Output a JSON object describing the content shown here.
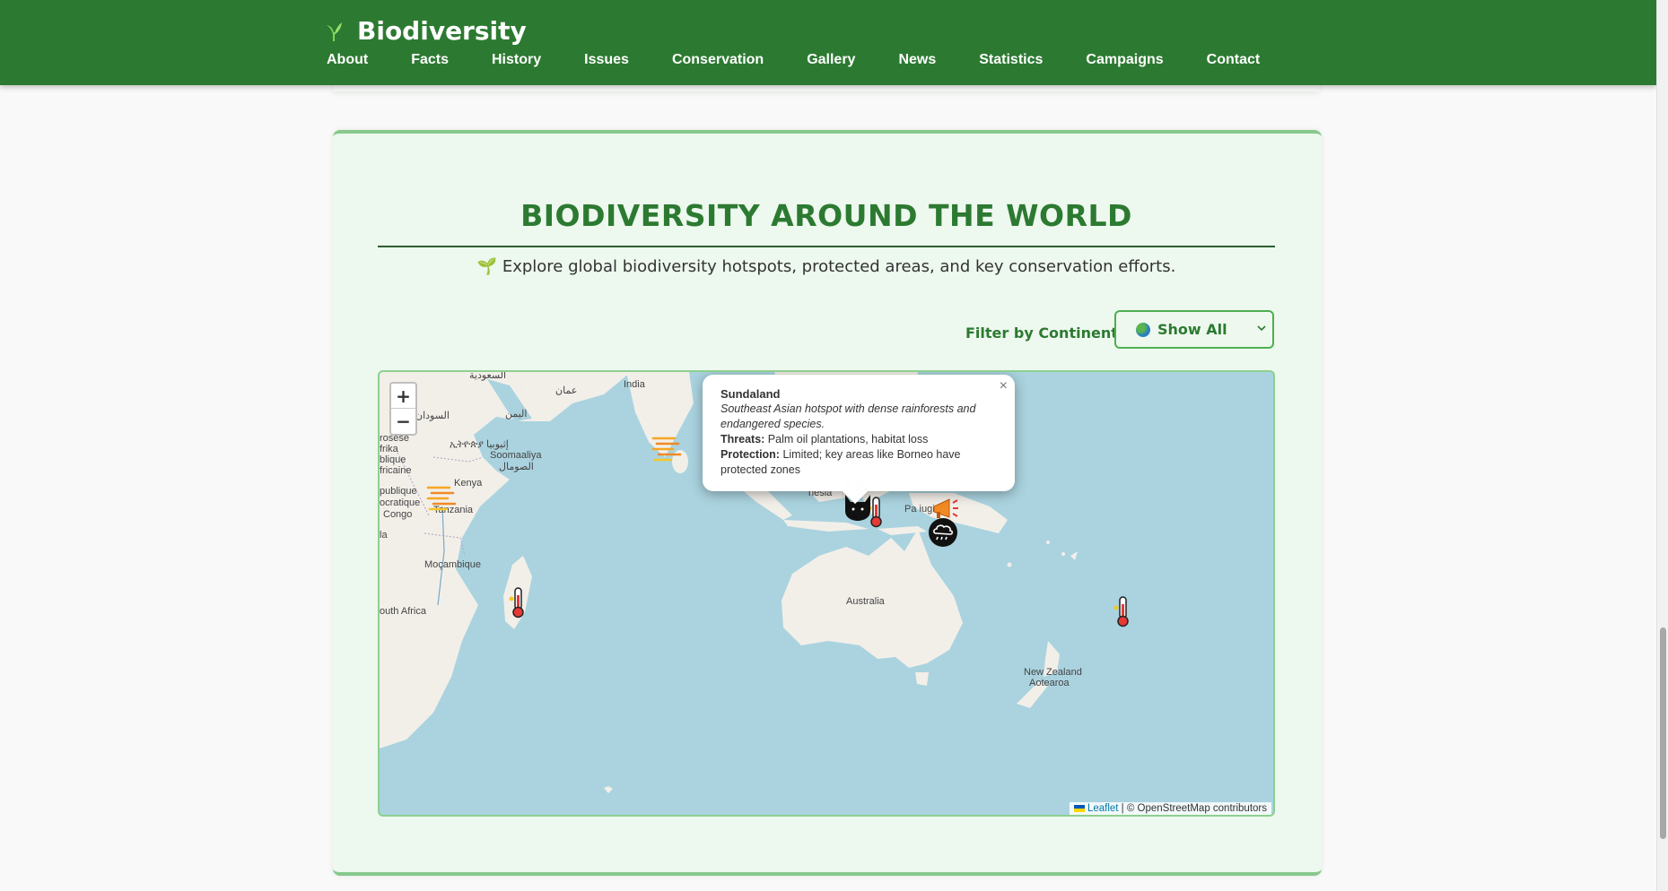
{
  "header": {
    "brand": "Biodiversity",
    "nav": [
      "About",
      "Facts",
      "History",
      "Issues",
      "Conservation",
      "Gallery",
      "News",
      "Statistics",
      "Campaigns",
      "Contact"
    ]
  },
  "section": {
    "title": "BIODIVERSITY AROUND THE WORLD",
    "subtitle": "🌱 Explore global biodiversity hotspots, protected areas, and key conservation efforts.",
    "filter": {
      "label": "Filter by Continent:",
      "value": "Show All"
    }
  },
  "map": {
    "zoom_in": "+",
    "zoom_out": "−",
    "labels": {
      "india": "India",
      "oman": "عمان",
      "saudi": "السعودية",
      "yemen": "اليمن",
      "sudan": "السودان",
      "ethiopia": "ኢትዮጵያ إثيوبيا",
      "somalia": "Soomaaliya",
      "somalia_ar": "الصومال",
      "car1": "rosèse",
      "car2": "frika",
      "car3": "blique",
      "car4": "fricaine",
      "drc1": "publique",
      "drc2": "ocratique",
      "drc3": "Congo",
      "kenya": "Kenya",
      "tanzania": "Tanzania",
      "la": "la",
      "mozambique": "Moçambique",
      "south_africa": "outh Africa",
      "indonesia": "nesia",
      "png": "Pa       iugini",
      "australia": "Australia",
      "nz1": "New Zealand",
      "nz2": "Aotearoa"
    },
    "popup": {
      "title": "Sundaland",
      "description": "Southeast Asian hotspot with dense rainforests and endangered species.",
      "threats_label": "Threats:",
      "threats": " Palm oil plantations, habitat loss",
      "protection_label": "Protection:",
      "protection": " Limited; key areas like Borneo have protected zones",
      "close": "×"
    },
    "attribution": {
      "leaflet": "Leaflet",
      "rest": " | © OpenStreetMap contributors"
    }
  }
}
